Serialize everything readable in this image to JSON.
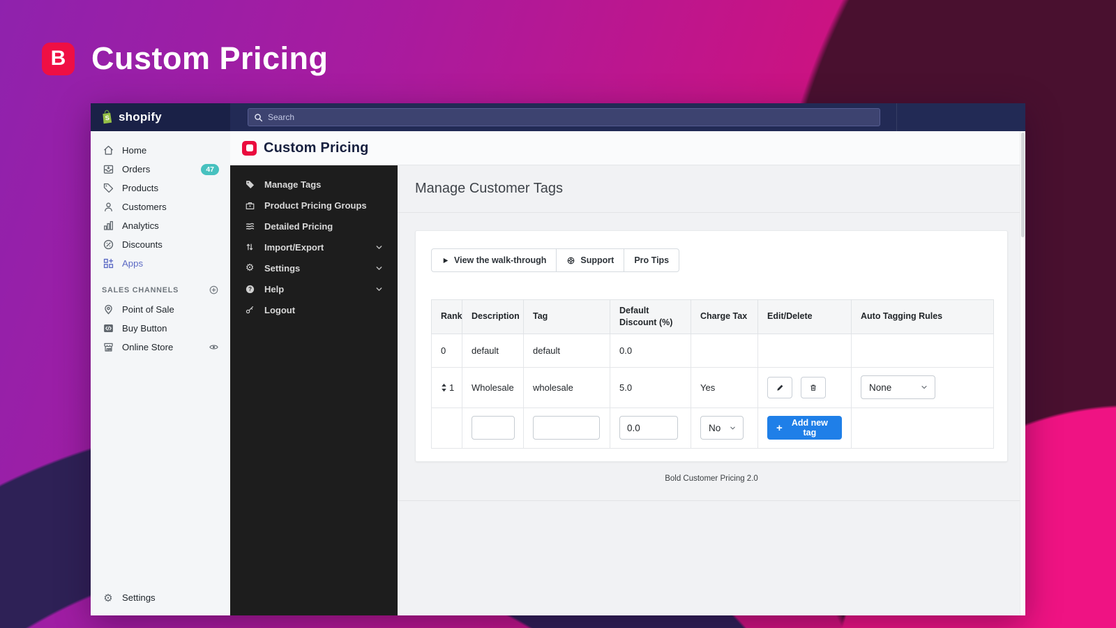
{
  "hero": {
    "logo_letter": "B",
    "title": "Custom Pricing"
  },
  "topbar": {
    "search_placeholder": "Search"
  },
  "shopify_sidebar": {
    "logo": "shopify",
    "items": [
      {
        "label": "Home"
      },
      {
        "label": "Orders",
        "badge": "47"
      },
      {
        "label": "Products"
      },
      {
        "label": "Customers"
      },
      {
        "label": "Analytics"
      },
      {
        "label": "Discounts"
      },
      {
        "label": "Apps"
      }
    ],
    "sales_channels_heading": "SALES CHANNELS",
    "channels": [
      {
        "label": "Point of Sale"
      },
      {
        "label": "Buy Button"
      },
      {
        "label": "Online Store"
      }
    ],
    "settings": "Settings"
  },
  "app": {
    "title": "Custom Pricing",
    "menu": [
      {
        "label": "Manage Tags"
      },
      {
        "label": "Product Pricing Groups"
      },
      {
        "label": "Detailed Pricing"
      },
      {
        "label": "Import/Export"
      },
      {
        "label": "Settings"
      },
      {
        "label": "Help"
      },
      {
        "label": "Logout"
      }
    ],
    "page_title": "Manage Customer Tags",
    "toolbar": {
      "walkthrough": "View the walk-through",
      "support": "Support",
      "pro_tips": "Pro Tips"
    },
    "table": {
      "headers": [
        "Rank",
        "Description",
        "Tag",
        "Default Discount (%)",
        "Charge Tax",
        "Edit/Delete",
        "Auto Tagging Rules"
      ],
      "rows": [
        {
          "rank": "0",
          "description": "default",
          "tag": "default",
          "discount": "0.0",
          "charge_tax": ""
        },
        {
          "rank": "1",
          "description": "Wholesale",
          "tag": "wholesale",
          "discount": "5.0",
          "charge_tax": "Yes",
          "auto_tagging": "None"
        }
      ],
      "new_row": {
        "discount": "0.0",
        "charge_tax": "No",
        "add_label": "Add new tag"
      }
    },
    "footer": "Bold Customer Pricing 2.0"
  },
  "colors": {
    "bold_red": "#ea0c3e",
    "shopify_green": "#95bf47",
    "badge_teal": "#47c1bf",
    "apps_indigo": "#5c6ac4",
    "add_button_blue": "#1f7fe8",
    "topbar_navy": "#222a55"
  }
}
